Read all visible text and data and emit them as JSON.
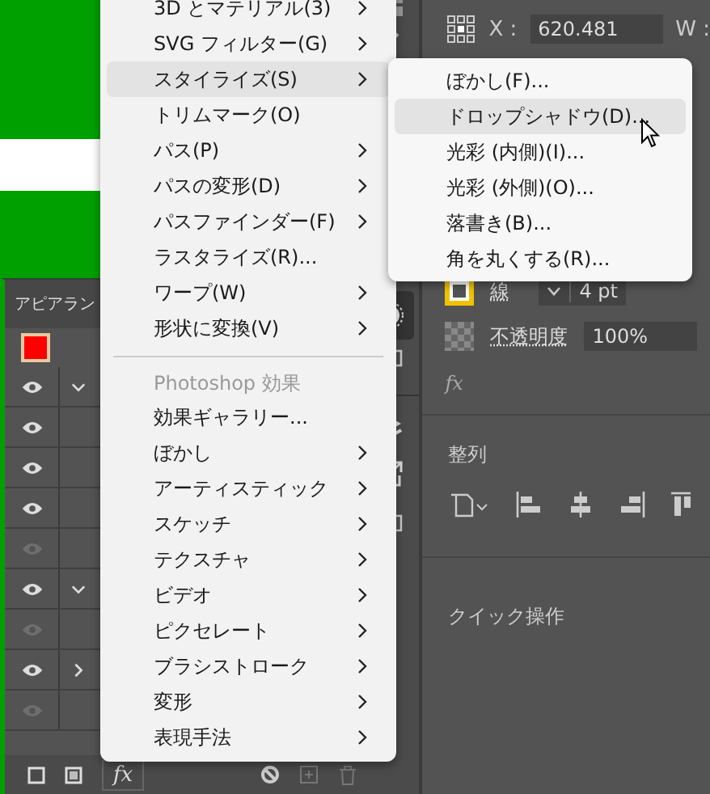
{
  "appearance_panel": {
    "title": "アピアラン",
    "rows": [
      {
        "visible": true,
        "expanded": true
      },
      {
        "visible": true
      },
      {
        "visible": true
      },
      {
        "visible": true
      },
      {
        "visible": false
      },
      {
        "visible": true,
        "expanded": true
      },
      {
        "visible": false
      },
      {
        "visible": true,
        "expanded": false
      },
      {
        "visible": false
      }
    ],
    "fx_label": "fx"
  },
  "effect_menu": {
    "items": [
      {
        "kind": "item",
        "label": "3D とマテリアル(3)",
        "submenu": true,
        "selected": false
      },
      {
        "kind": "item",
        "label": "SVG フィルター(G)",
        "submenu": true,
        "selected": false
      },
      {
        "kind": "item",
        "label": "スタイライズ(S)",
        "submenu": true,
        "selected": true
      },
      {
        "kind": "item",
        "label": "トリムマーク(O)",
        "submenu": false,
        "selected": false
      },
      {
        "kind": "item",
        "label": "パス(P)",
        "submenu": true,
        "selected": false
      },
      {
        "kind": "item",
        "label": "パスの変形(D)",
        "submenu": true,
        "selected": false
      },
      {
        "kind": "item",
        "label": "パスファインダー(F)",
        "submenu": true,
        "selected": false
      },
      {
        "kind": "item",
        "label": "ラスタライズ(R)...",
        "submenu": false,
        "selected": false
      },
      {
        "kind": "item",
        "label": "ワープ(W)",
        "submenu": true,
        "selected": false
      },
      {
        "kind": "item",
        "label": "形状に変換(V)",
        "submenu": true,
        "selected": false
      },
      {
        "kind": "separator"
      },
      {
        "kind": "header",
        "label": "Photoshop 効果"
      },
      {
        "kind": "item",
        "label": "効果ギャラリー...",
        "submenu": false,
        "selected": false
      },
      {
        "kind": "item",
        "label": "ぼかし",
        "submenu": true,
        "selected": false
      },
      {
        "kind": "item",
        "label": "アーティスティック",
        "submenu": true,
        "selected": false
      },
      {
        "kind": "item",
        "label": "スケッチ",
        "submenu": true,
        "selected": false
      },
      {
        "kind": "item",
        "label": "テクスチャ",
        "submenu": true,
        "selected": false
      },
      {
        "kind": "item",
        "label": "ビデオ",
        "submenu": true,
        "selected": false
      },
      {
        "kind": "item",
        "label": "ピクセレート",
        "submenu": true,
        "selected": false
      },
      {
        "kind": "item",
        "label": "ブラシストローク",
        "submenu": true,
        "selected": false
      },
      {
        "kind": "item",
        "label": "変形",
        "submenu": true,
        "selected": false
      },
      {
        "kind": "item",
        "label": "表現手法",
        "submenu": true,
        "selected": false
      }
    ]
  },
  "stylize_submenu": {
    "items": [
      {
        "label": "ぼかし(F)...",
        "selected": false
      },
      {
        "label": "ドロップシャドウ(D)...",
        "selected": true
      },
      {
        "label": "光彩 (内側)(I)...",
        "selected": false
      },
      {
        "label": "光彩 (外側)(O)...",
        "selected": false
      },
      {
        "label": "落書き(B)...",
        "selected": false
      },
      {
        "label": "角を丸くする(R)...",
        "selected": false
      }
    ]
  },
  "properties_panel": {
    "transform": {
      "x_label": "X :",
      "x_value": "620.481",
      "w_label": "W :"
    },
    "stroke": {
      "label": "線",
      "value": "4 pt"
    },
    "opacity": {
      "label": "不透明度",
      "value": "100%"
    },
    "fx_label": "fx",
    "align_title": "整列",
    "quick_actions_title": "クイック操作"
  }
}
